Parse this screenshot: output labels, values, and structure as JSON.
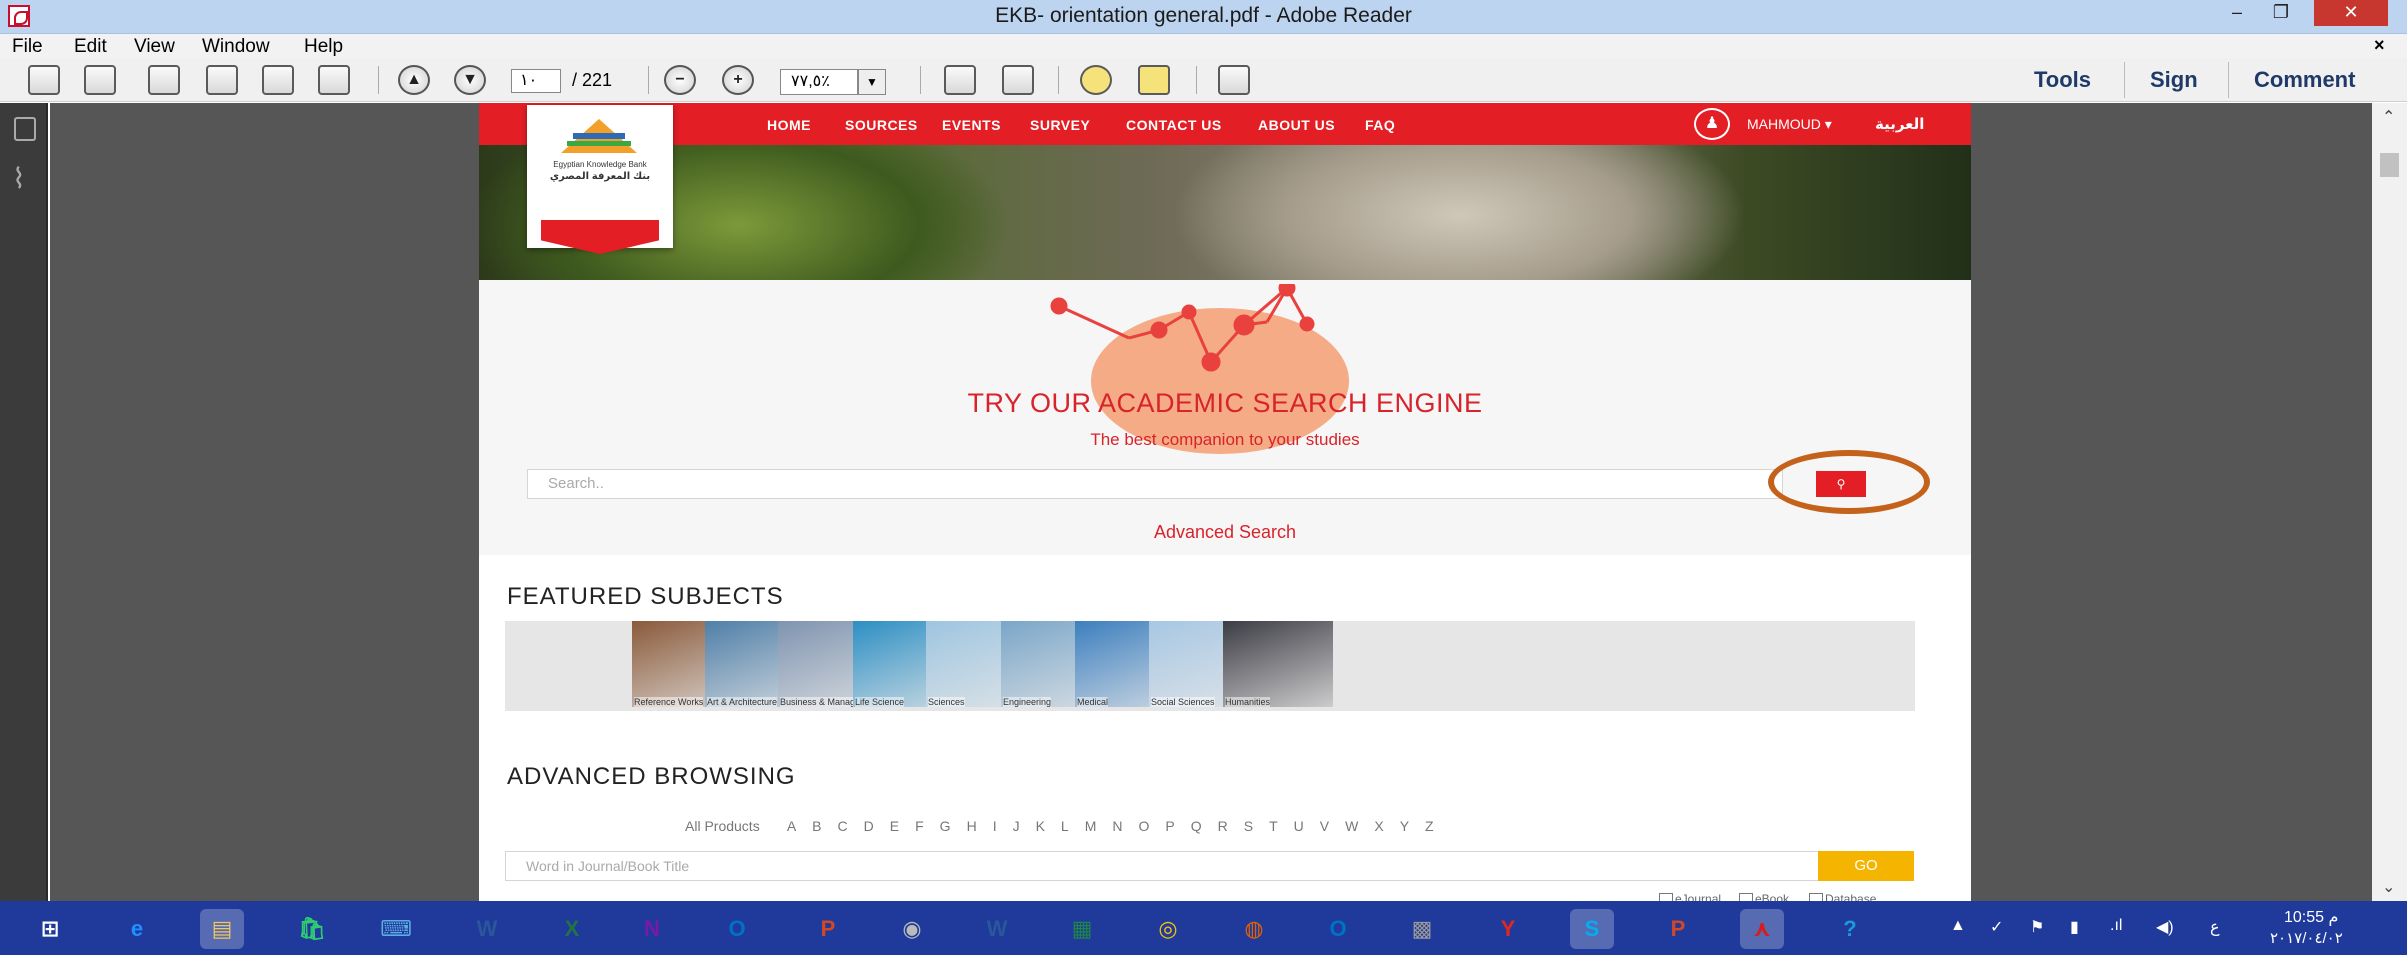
{
  "window": {
    "title": "EKB- orientation general.pdf - Adobe Reader",
    "min_glyph": "–",
    "max_glyph": "❐",
    "close_glyph": "✕"
  },
  "menu": [
    "File",
    "Edit",
    "View",
    "Window",
    "Help"
  ],
  "menu_close": "×",
  "toolbar": {
    "page_current": "١٠",
    "page_total": "/ 221",
    "zoom": "٧٧,٥٪",
    "zoom_dropdown": "▼",
    "minus": "−",
    "plus": "+",
    "tools": "Tools",
    "sign": "Sign",
    "comment": "Comment"
  },
  "scrollbar": {
    "up": "⌃",
    "down": "⌄"
  },
  "page": {
    "nav": [
      "HOME",
      "SOURCES",
      "EVENTS",
      "SURVEY",
      "CONTACT US",
      "ABOUT US",
      "FAQ"
    ],
    "user": "MAHMOUD ▾",
    "arabic": "العربية",
    "logo_line1": "Egyptian Knowledge Bank",
    "logo_line2": "بنك المعرفة المصري",
    "headline": "TRY OUR ACADEMIC SEARCH ENGINE",
    "subline": "The best companion to your studies",
    "search_placeholder": "Search..",
    "search_glyph": "⚲",
    "advanced_search": "Advanced Search",
    "featured_title": "FEATURED SUBJECTS",
    "subjects": [
      "Reference Works",
      "Art & Architecture",
      "Business & Management",
      "Life Science",
      "Sciences",
      "Engineering",
      "Medical",
      "Social Sciences",
      "Humanities"
    ],
    "subject_colors": [
      "#8a5a3a",
      "#4f7fa8",
      "#7f94b0",
      "#2d8fc4",
      "#9ec5e0",
      "#7aa6c8",
      "#3c7fbf",
      "#a7c7e3",
      "#3c3c44"
    ],
    "advanced_title": "ADVANCED BROWSING",
    "all_products": "All Products",
    "letters": [
      "A",
      "B",
      "C",
      "D",
      "E",
      "F",
      "G",
      "H",
      "I",
      "J",
      "K",
      "L",
      "M",
      "N",
      "O",
      "P",
      "Q",
      "R",
      "S",
      "T",
      "U",
      "V",
      "W",
      "X",
      "Y",
      "Z"
    ],
    "browse_placeholder": "Word in Journal/Book Title",
    "go": "GO",
    "checkboxes": [
      "eJournal",
      "eBook",
      "Database"
    ]
  },
  "taskbar": {
    "icons": [
      "windows-start-icon",
      "internet-explorer-icon",
      "file-explorer-icon",
      "store-icon",
      "remote-desktop-icon",
      "word-icon",
      "excel-icon",
      "onenote-icon",
      "outlook-icon",
      "powerpoint-icon",
      "camera-icon",
      "word-icon-2",
      "calculator-icon",
      "chrome-icon",
      "firefox-icon",
      "outlook-icon-2",
      "network-icon",
      "yandex-icon",
      "skype-icon",
      "powerpoint-icon-2",
      "acrobat-icon",
      "help-icon"
    ],
    "glyphs": [
      "⊞",
      "e",
      "▤",
      "🛍",
      "⌨",
      "W",
      "X",
      "N",
      "O",
      "P",
      "◉",
      "W",
      "▦",
      "◎",
      "◍",
      "O",
      "▩",
      "Y",
      "S",
      "P",
      "⋏",
      "?"
    ],
    "colors": [
      "#ffffff",
      "#1e90ff",
      "#f0c75e",
      "#2ecc71",
      "#5dade2",
      "#2b579a",
      "#217346",
      "#7719aa",
      "#0072c6",
      "#d24726",
      "#bbbbbb",
      "#2b579a",
      "#1e8449",
      "#f4c20d",
      "#e66000",
      "#0072c6",
      "#999999",
      "#e52620",
      "#00aff0",
      "#d24726",
      "#d71c1c",
      "#1b9ad6"
    ],
    "tray_glyphs": [
      "▲",
      "✓",
      "⚑",
      "▮",
      ".ıl",
      "◀)",
      "ع"
    ],
    "time": "10:55 م",
    "date": "٢٠١٧/٠٤/٠٢"
  }
}
